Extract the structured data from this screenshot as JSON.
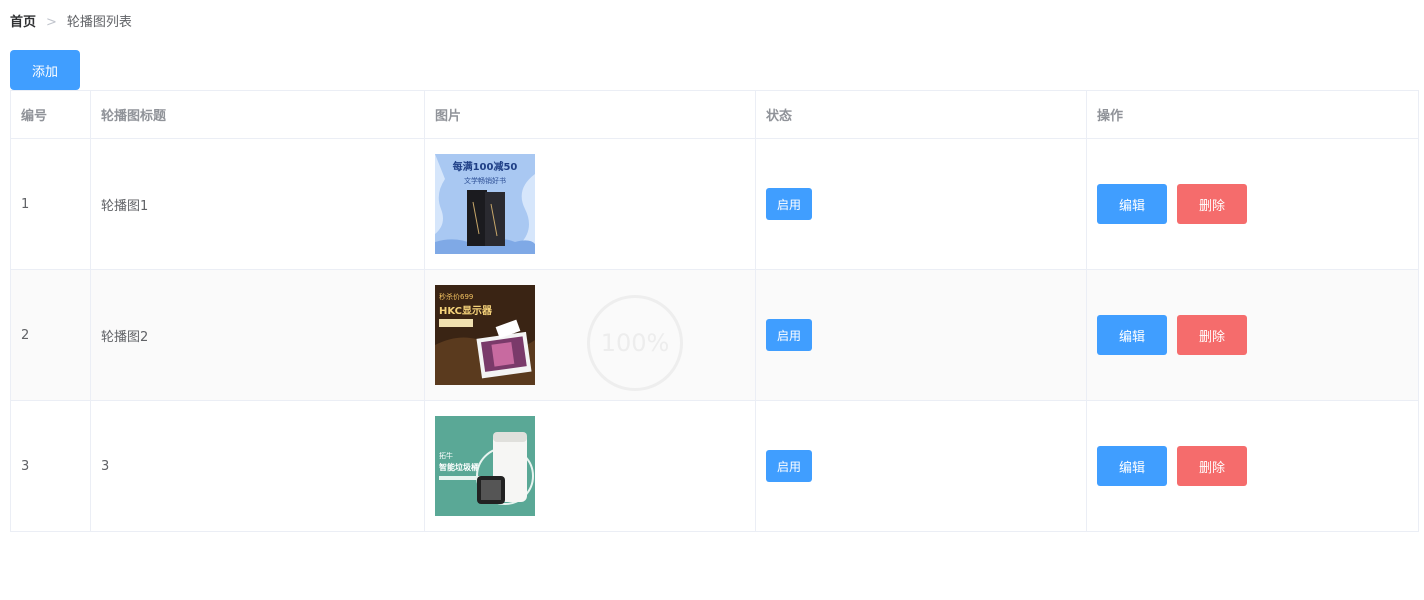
{
  "breadcrumb": {
    "home": "首页",
    "separator": ">",
    "current": "轮播图列表"
  },
  "toolbar": {
    "add_label": "添加"
  },
  "table": {
    "headers": {
      "id": "编号",
      "title": "轮播图标题",
      "image": "图片",
      "status": "状态",
      "actions": "操作"
    },
    "rows": [
      {
        "id": "1",
        "title": "轮播图1",
        "image": {
          "headline": "每满100减50",
          "sub": "文学畅销好书"
        },
        "status": "启用",
        "edit": "编辑",
        "delete": "删除"
      },
      {
        "id": "2",
        "title": "轮播图2",
        "image": {
          "headline": "HKC显示器",
          "sub": "秒杀价699"
        },
        "status": "启用",
        "edit": "编辑",
        "delete": "删除"
      },
      {
        "id": "3",
        "title": "3",
        "image": {
          "headline": "智能垃圾桶",
          "sub": "拓牛"
        },
        "status": "启用",
        "edit": "编辑",
        "delete": "删除"
      }
    ]
  },
  "loading": {
    "percent": "100%"
  },
  "colors": {
    "primary": "#409eff",
    "danger": "#f56c6c",
    "border": "#ebeef5",
    "stripe": "#fafafa"
  }
}
